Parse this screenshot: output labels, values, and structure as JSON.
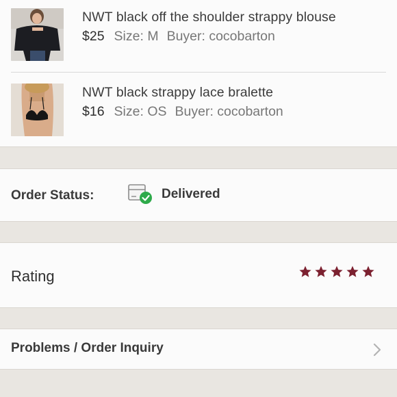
{
  "items": [
    {
      "title": "NWT black off the shoulder strappy blouse",
      "price": "$25",
      "size": "Size: M",
      "buyer": "Buyer: cocobarton"
    },
    {
      "title": "NWT black strappy lace bralette",
      "price": "$16",
      "size": "Size: OS",
      "buyer": "Buyer: cocobarton"
    }
  ],
  "order_status": {
    "label": "Order Status:",
    "value": "Delivered",
    "icon": "box-check-icon",
    "accent_color": "#2eaa4a"
  },
  "rating": {
    "label": "Rating",
    "stars": 5,
    "max_stars": 5,
    "star_color": "#7c2130"
  },
  "problems": {
    "label": "Problems / Order Inquiry",
    "icon": "chevron-right-icon"
  }
}
